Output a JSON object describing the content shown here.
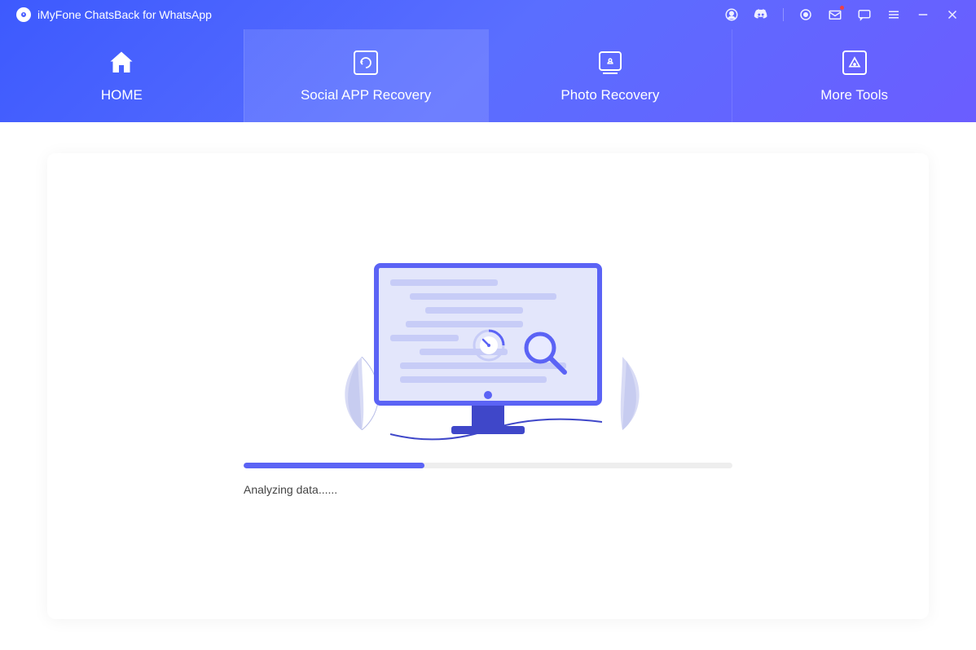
{
  "app": {
    "title": "iMyFone ChatsBack for WhatsApp"
  },
  "tabs": [
    {
      "label": "HOME"
    },
    {
      "label": "Social APP Recovery"
    },
    {
      "label": "Photo Recovery"
    },
    {
      "label": "More Tools"
    }
  ],
  "progress": {
    "status": "Analyzing data......",
    "percent": 37
  }
}
